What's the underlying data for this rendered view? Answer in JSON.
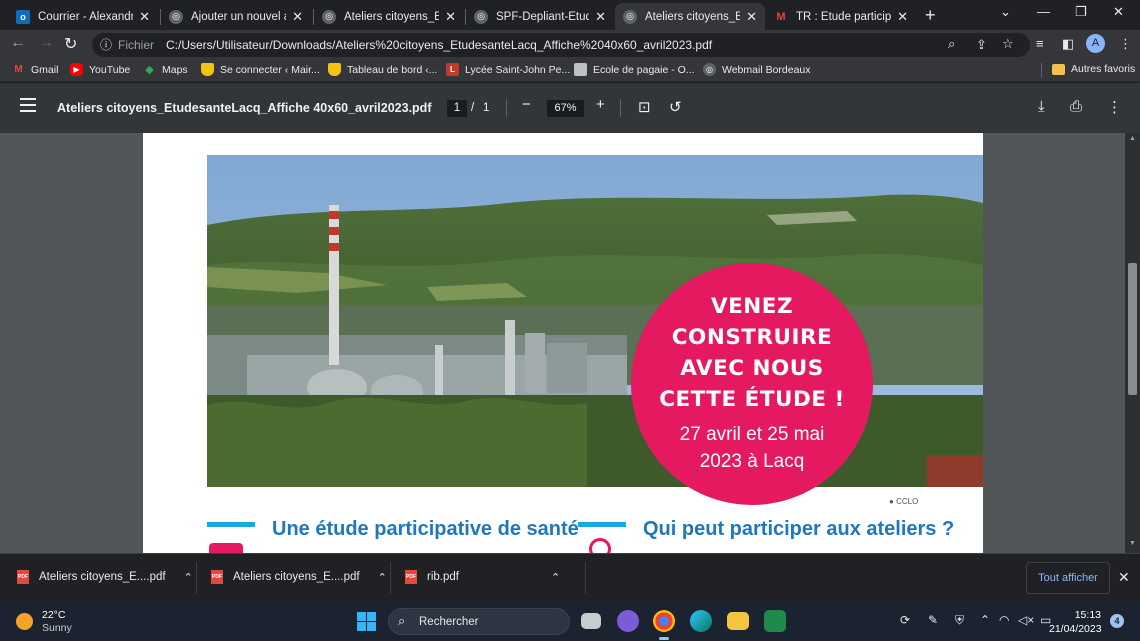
{
  "tabs": [
    {
      "title": "Courrier - Alexandra L",
      "icon": "outlook-icon",
      "color": "#0f6cbd",
      "letter": "o"
    },
    {
      "title": "Ajouter un nouvel artic",
      "icon": "globe-icon",
      "color": "#5f6368",
      "letter": ""
    },
    {
      "title": "Ateliers citoyens_Etud",
      "icon": "globe-icon",
      "color": "#5f6368",
      "letter": ""
    },
    {
      "title": "SPF-Depliant-EtudeLa",
      "icon": "globe-icon",
      "color": "#5f6368",
      "letter": ""
    },
    {
      "title": "Ateliers citoyens_Etud",
      "icon": "globe-icon",
      "color": "#5f6368",
      "letter": "",
      "active": true
    },
    {
      "title": "TR : Etude participative",
      "icon": "gmail-icon",
      "color": "#ea4335",
      "letter": "M"
    }
  ],
  "omnibox": {
    "scheme_label": "Fichier",
    "url": "C:/Users/Utilisateur/Downloads/Ateliers%20citoyens_EtudesanteLacq_Affiche%2040x60_avril2023.pdf"
  },
  "profile_letter": "A",
  "bookmarks": [
    {
      "label": "Gmail",
      "icon": "gmail-icon",
      "color": "#ea4335",
      "letter": "M"
    },
    {
      "label": "YouTube",
      "icon": "youtube-icon",
      "color": "#ff0000",
      "letter": "▶"
    },
    {
      "label": "Maps",
      "icon": "maps-icon",
      "color": "#34a853",
      "letter": "◆"
    },
    {
      "label": "Se connecter ‹ Mair...",
      "icon": "shield-icon",
      "color": "#f1c40f",
      "letter": ""
    },
    {
      "label": "Tableau de bord ‹...",
      "icon": "shield-icon",
      "color": "#f1c40f",
      "letter": ""
    },
    {
      "label": "Lycée Saint-John Pe...",
      "icon": "school-icon",
      "color": "#c0392b",
      "letter": "L"
    },
    {
      "label": "Ecole de pagaie - O...",
      "icon": "page-icon",
      "color": "#bdc1c6",
      "letter": ""
    },
    {
      "label": "Webmail Bordeaux",
      "icon": "globe-icon",
      "color": "#5f6368",
      "letter": ""
    }
  ],
  "bookmarks_other": "Autres favoris",
  "pdf": {
    "title": "Ateliers citoyens_EtudesanteLacq_Affiche 40x60_avril2023.pdf",
    "page_current": "1",
    "page_sep": "/",
    "page_total": "1",
    "zoom": "67%"
  },
  "poster": {
    "headline_lines": [
      "VENEZ",
      "CONSTRUIRE",
      "AVEC NOUS",
      "CETTE ÉTUDE !"
    ],
    "date_lines": [
      "27 avril et 25 mai",
      "2023 à Lacq"
    ],
    "photo_credit": "CCLO",
    "section_left": "Une étude participative de santé",
    "section_right": "Qui peut participer aux ateliers ?",
    "accent_color": "#e5195f",
    "title_color": "#1f77c0"
  },
  "downloads": [
    {
      "label": "Ateliers citoyens_E....pdf"
    },
    {
      "label": "Ateliers citoyens_E....pdf"
    },
    {
      "label": "rib.pdf"
    }
  ],
  "downloads_show_all": "Tout afficher",
  "weather": {
    "temp": "22°C",
    "condition": "Sunny"
  },
  "taskbar_search": "Rechercher",
  "clock": {
    "time": "15:13",
    "date": "21/04/2023"
  },
  "notification_count": "4"
}
